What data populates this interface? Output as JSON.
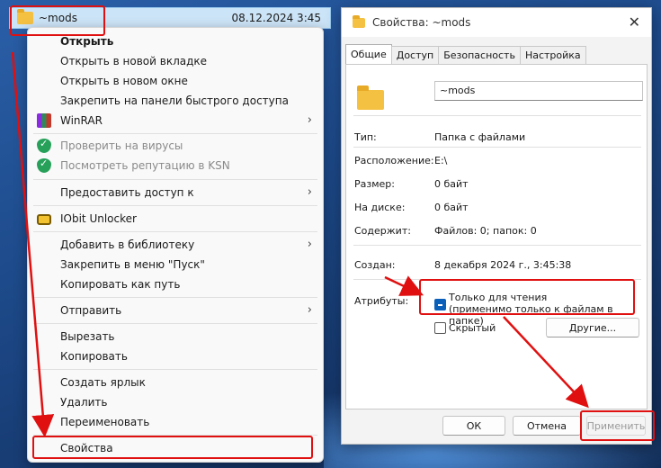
{
  "explorer_row": {
    "name": "~mods",
    "date": "08.12.2024 3:45"
  },
  "context_menu": {
    "items": [
      {
        "label": "Открыть",
        "bold": true
      },
      {
        "label": "Открыть в новой вкладке"
      },
      {
        "label": "Открыть в новом окне"
      },
      {
        "label": "Закрепить на панели быстрого доступа"
      },
      {
        "label": "WinRAR",
        "icon": "winrar-icon",
        "submenu": true
      },
      {
        "label": "Проверить на вирусы",
        "icon": "kaspersky-shield-icon",
        "disabled": true
      },
      {
        "label": "Посмотреть репутацию в KSN",
        "icon": "kaspersky-shield-icon",
        "disabled": true
      },
      {
        "label": "Предоставить доступ к",
        "submenu": true
      },
      {
        "label": "IObit Unlocker",
        "icon": "lock-icon"
      },
      {
        "label": "Добавить в библиотеку",
        "submenu": true
      },
      {
        "label": "Закрепить в меню \"Пуск\""
      },
      {
        "label": "Копировать как путь"
      },
      {
        "label": "Отправить",
        "submenu": true
      },
      {
        "label": "Вырезать"
      },
      {
        "label": "Копировать"
      },
      {
        "label": "Создать ярлык"
      },
      {
        "label": "Удалить"
      },
      {
        "label": "Переименовать"
      },
      {
        "label": "Свойства"
      }
    ],
    "chevron": "›"
  },
  "dialog": {
    "title": "Свойства: ~mods",
    "close_glyph": "✕",
    "tabs": [
      "Общие",
      "Доступ",
      "Безопасность",
      "Настройка"
    ],
    "name_value": "~mods",
    "rows": [
      {
        "label": "Тип:",
        "value": "Папка с файлами"
      },
      {
        "label": "Расположение:",
        "value": "E:\\"
      },
      {
        "label": "Размер:",
        "value": "0 байт"
      },
      {
        "label": "На диске:",
        "value": "0 байт"
      },
      {
        "label": "Содержит:",
        "value": "Файлов: 0; папок: 0"
      },
      {
        "label": "Создан:",
        "value": "8 декабря 2024 г., 3:45:38"
      }
    ],
    "attributes_label": "Атрибуты:",
    "readonly_line1": "Только для чтения",
    "readonly_line2": "(применимо только к файлам в папке)",
    "hidden_label": "Скрытый",
    "other_button": "Другие...",
    "ok_button": "ОК",
    "cancel_button": "Отмена",
    "apply_button": "Применить"
  },
  "colors": {
    "annotation": "#e01010",
    "accent": "#0a5fb8",
    "selection": "#cce4f7"
  }
}
